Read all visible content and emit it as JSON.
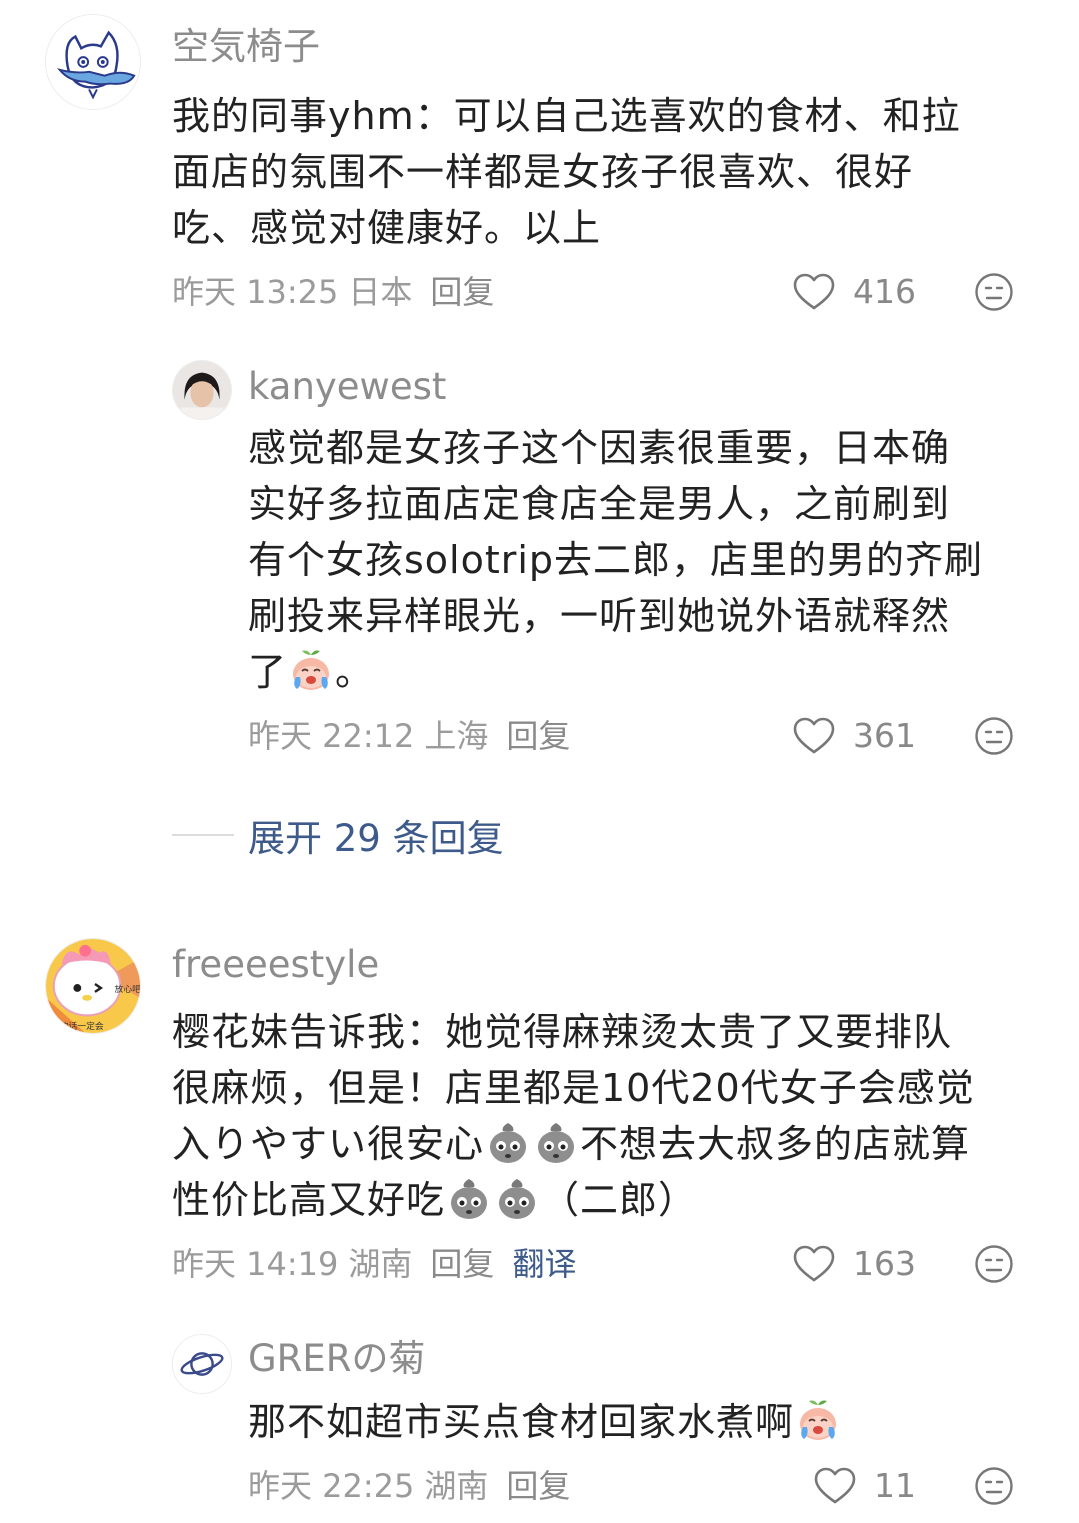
{
  "comments": [
    {
      "username": "空気椅子",
      "text_lines": [
        "我的同事yhm：可以自己选喜欢的食材、和拉",
        "面店的氛围不一样都是女孩子很喜欢、很好",
        "吃、感觉对健康好。以上"
      ],
      "time": "昨天 13:25",
      "location": "日本",
      "reply_label": "回复",
      "likes": "416",
      "avatar_icon": "cat-doodle-avatar-icon"
    },
    {
      "username": "kanyewest",
      "text_lines": [
        "感觉都是女孩子这个因素很重要，日本确",
        "实好多拉面店定食店全是男人，之前刷到",
        "有个女孩solotrip去二郎，店里的男的齐刷",
        "刷投来异样眼光，一听到她说外语就释然"
      ],
      "text_last": "了",
      "text_last_end": "。",
      "time": "昨天 22:12",
      "location": "上海",
      "reply_label": "回复",
      "likes": "361",
      "avatar_icon": "person-photo-avatar-icon"
    },
    {
      "username": "freeeestyle",
      "text_line1": "樱花妹告诉我：她觉得麻辣烫太贵了又要排队",
      "text_line2": "很麻烦，但是！店里都是10代20代女子会感觉",
      "text_line3a": "入りやすい很安心",
      "text_line3b": "不想去大叔多的店就算",
      "text_line4a": "性价比高又好吃",
      "text_line4b": "（二郎）",
      "time": "昨天 14:19",
      "location": "湖南",
      "reply_label": "回复",
      "translate_label": "翻译",
      "likes": "163",
      "avatar_icon": "melody-avatar-icon",
      "avatar_text_1": "放心吧",
      "avatar_text_2": "的话一定会"
    },
    {
      "username": "GRERの菊",
      "text": "那不如超市买点食材回家水煮啊",
      "time": "昨天 22:25",
      "location": "湖南",
      "reply_label": "回复",
      "likes": "11",
      "avatar_icon": "planet-avatar-icon"
    }
  ],
  "expand": {
    "label": "展开 29 条回复"
  },
  "colors": {
    "username": "#8c8c8c",
    "text": "#222222",
    "meta": "#9b9b9b",
    "link": "#3d5a8a"
  }
}
